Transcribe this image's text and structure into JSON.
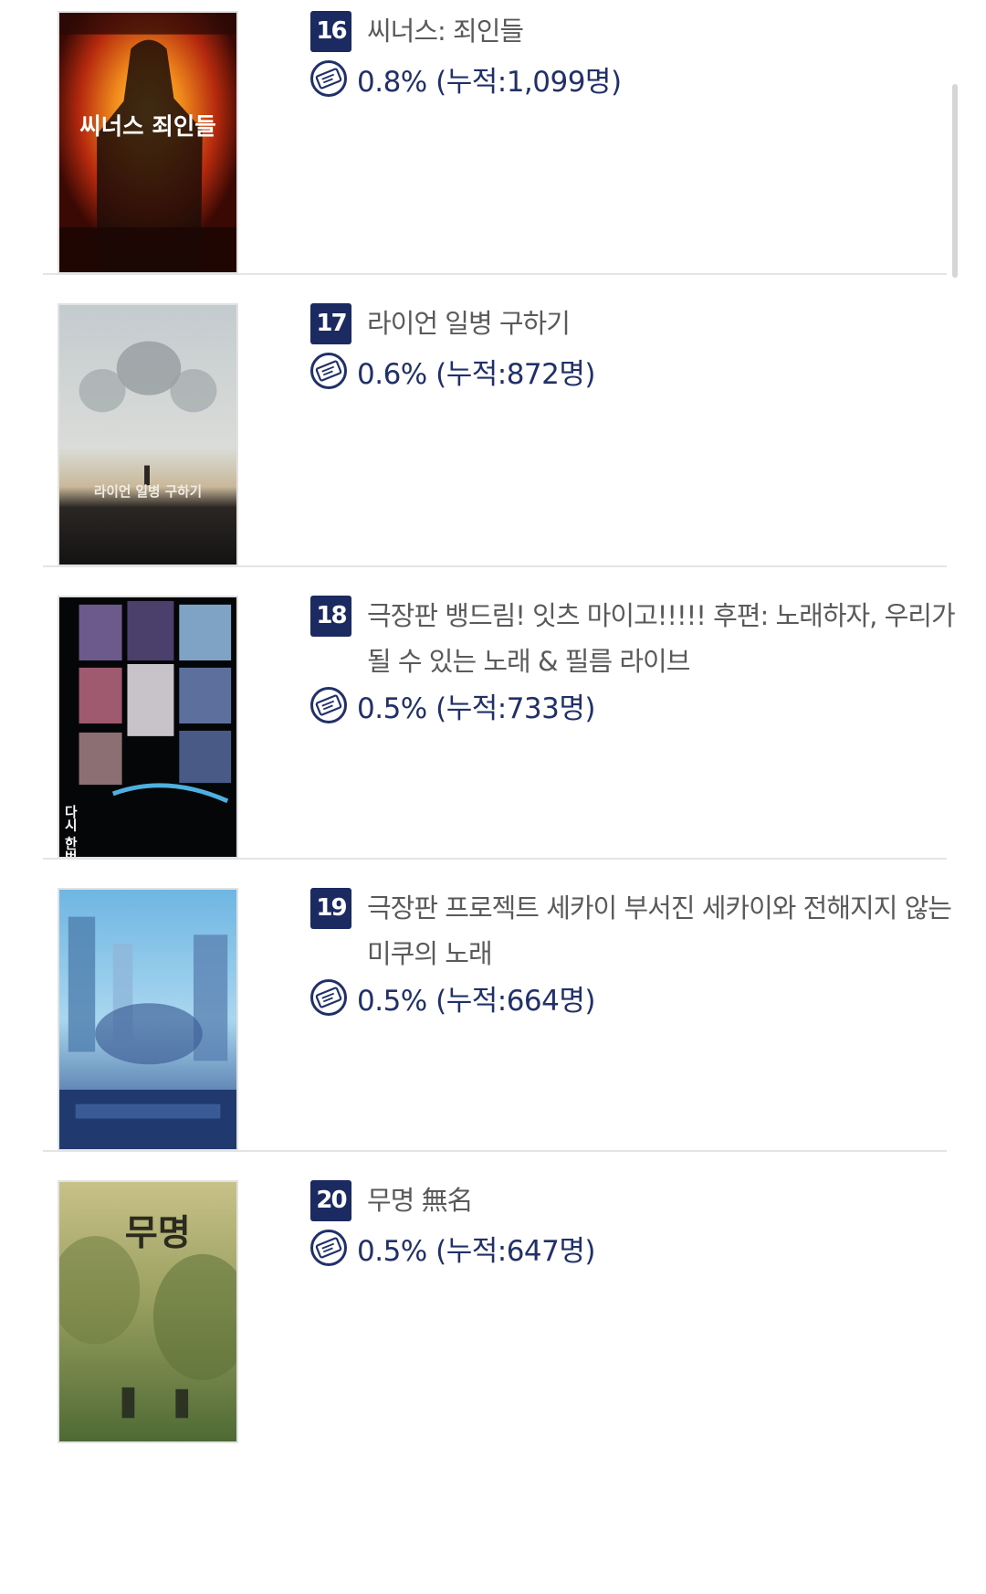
{
  "colors": {
    "rank_badge": "#1b2b62",
    "share_text": "#22306a",
    "title_text": "#5a5a5a",
    "divider": "#e4e4e4"
  },
  "movies": [
    {
      "rank": "16",
      "title": "씨너스: 죄인들",
      "share": "0.8% (누적:1,099명)",
      "poster_icon": "movie-poster",
      "poster_text": "씨너스 죄인들"
    },
    {
      "rank": "17",
      "title": "라이언 일병 구하기",
      "share": "0.6% (누적:872명)",
      "poster_icon": "movie-poster",
      "poster_text": "라이언 일병 구하기"
    },
    {
      "rank": "18",
      "title": "극장판 뱅드림! 잇츠 마이고!!!!! 후편: 노래하자, 우리가 될 수 있는 노래 & 필름 라이브",
      "share": "0.5% (누적:733명)",
      "poster_icon": "movie-poster",
      "poster_text": "다시 한번"
    },
    {
      "rank": "19",
      "title": "극장판 프로젝트 세카이 부서진 세카이와 전해지지 않는 미쿠의 노래",
      "share": "0.5% (누적:664명)",
      "poster_icon": "movie-poster",
      "poster_text": ""
    },
    {
      "rank": "20",
      "title": "무명 無名",
      "share": "0.5% (누적:647명)",
      "poster_icon": "movie-poster",
      "poster_text": "무명"
    }
  ]
}
